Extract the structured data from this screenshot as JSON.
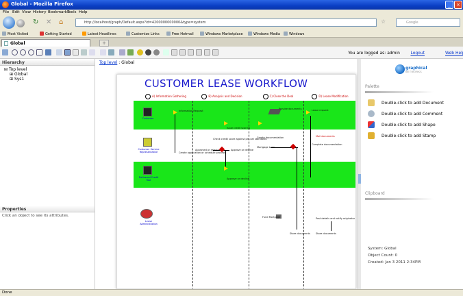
{
  "window": {
    "title": "Global - Mozilla Firefox"
  },
  "menu": [
    "File",
    "Edit",
    "View",
    "History",
    "Bookmarks",
    "Tools",
    "Help"
  ],
  "nav": {
    "url": "http://localhost/graph/Default.aspx?id=4200000000000&type=system",
    "search_placeholder": "Google"
  },
  "bookmarks": [
    "Most Visited",
    "Getting Started",
    "Latest Headlines",
    "Customize Links",
    "Free Hotmail",
    "Windows Marketplace",
    "Windows Media",
    "Windows"
  ],
  "tab": {
    "label": "Global",
    "new_tab": "+"
  },
  "app": {
    "logged_as": "You are logged as: admin",
    "logout": "Logout",
    "web_help": "Web Help"
  },
  "hierarchy": {
    "title": "Hierarchy",
    "items": [
      "Top level",
      "Global",
      "Sys1"
    ]
  },
  "properties": {
    "title": "Properties",
    "hint": "Click an object to see its attributes."
  },
  "breadcrumb": {
    "root": "Top level",
    "sep": " : ",
    "current": "Global"
  },
  "diagram": {
    "title": "CUSTOMER LEASE WORKFLOW",
    "phases": [
      "A) Information Gathering",
      "B) Analysis and Decision",
      "C) Close the Deal",
      "D) Lease Modification"
    ],
    "actors": [
      "Customer",
      "Customer Service Representative",
      "Delivered Credit Tool",
      "Lease Administration"
    ],
    "steps": [
      "Information Request",
      "Create application or schedule process",
      "Issue credit scoring",
      "Check credit score against pre-set standards",
      "Approved or rejected?",
      "Approve or decline",
      "Provide documents",
      "Create documentation",
      "Mortgage Loan",
      "Complete documentation",
      "Lease request",
      "Mail documents",
      "Post details and notify originator",
      "Store documents",
      "Store documents",
      "Approve or decline",
      "Fund Mortgage"
    ]
  },
  "palette": {
    "logo_main": "graphical",
    "logo_sub": "NETWORKS",
    "title": "Palette",
    "items": [
      "Double-click to add Document",
      "Double-click to add Comment",
      "Double-click to add Shape",
      "Double-click to add Stamp"
    ],
    "clipboard_title": "Clipboard"
  },
  "info": {
    "system": "System: Global",
    "object_count": "Object Count: 0",
    "created": "Created: Jan  3 2011  2:34PM"
  },
  "status": {
    "text": "Done"
  }
}
